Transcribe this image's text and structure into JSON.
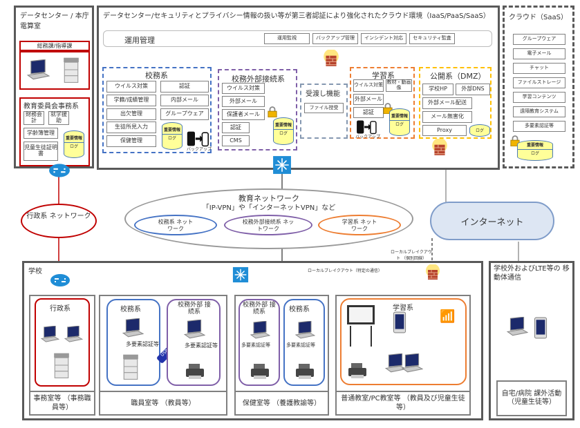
{
  "datacenter": {
    "title": "データセンター / 本庁 電算室",
    "general": "総務課/指導課",
    "board": {
      "title": "教育委員会事務系",
      "items": [
        "財務会計",
        "就学援助",
        "学齢簿管理",
        "児童生徒証明書"
      ],
      "db": [
        "重要情報",
        "ログ"
      ]
    }
  },
  "cloud_env": {
    "title": "データセンター/セキュリティとプライバシー情報の扱い等が第三者認証により強化されたクラウド環境（IaaS/PaaS/SaaS）",
    "ops": {
      "title": "運用管理",
      "items": [
        "運用監視",
        "バックアップ管理",
        "インシデント対応",
        "セキュリティ監査"
      ]
    },
    "koumu": {
      "title": "校務系",
      "left": [
        "ウイルス対策",
        "学籍/成績管理",
        "出欠管理",
        "生徒所見入力",
        "保健管理"
      ],
      "right": [
        "認証",
        "内部メール",
        "グループウェア"
      ],
      "db": [
        "重要情報",
        "ログ"
      ],
      "backup": "バックアップ"
    },
    "koumu_ext": {
      "title": "校務外部接続系",
      "items": [
        "ウイルス対策",
        "外部メール",
        "保護者メール",
        "認証",
        "CMS"
      ],
      "db": [
        "重要情報",
        "ログ"
      ]
    },
    "transfer": {
      "title": "受渡し機能",
      "items": [
        "ファイル授受"
      ]
    },
    "learning": {
      "title": "学習系",
      "items": [
        "ウイルス対策",
        "教材・動画像",
        "外部メール",
        "認証"
      ],
      "db": [
        "重要情報",
        "ログ"
      ],
      "backup": "バックアップ"
    },
    "dmz": {
      "title": "公開系（DMZ）",
      "items": [
        "学校HP",
        "外部DNS",
        "外部メール配送",
        "メール無害化",
        "Proxy"
      ],
      "log": "ログ"
    }
  },
  "saas": {
    "title": "クラウド（SaaS）",
    "items": [
      "グループウェア",
      "電子メール",
      "チャット",
      "ファイルストレージ",
      "学習コンテンツ",
      "遠隔教育システム",
      "多要素認証等"
    ],
    "db": [
      "重要情報",
      "ログ"
    ]
  },
  "admin_network": "行政系 ネットワーク",
  "edu_network": {
    "title": "教育ネットワーク",
    "subtitle": "「IP-VPN」や「インターネットVPN」など",
    "items": [
      "校務系 ネットワーク",
      "校務外部接続系 ネットワーク",
      "学習系 ネットワーク"
    ]
  },
  "internet": "インターネット",
  "breakout_individual": "ローカルブレイクアウト （個別回線）",
  "breakout_specific": "ローカルブレイクアウト（特定の通信）",
  "school": {
    "title": "学校",
    "office": {
      "group": "行政系",
      "label": "事務室等 （事務職員等）"
    },
    "staff": {
      "groups": [
        "校務系",
        "校務外部 接続系"
      ],
      "mfa": "多要素認証等",
      "usb": "USB",
      "label": "職員室等 （教員等）"
    },
    "health": {
      "groups": [
        "校務外部 接続系",
        "校務系"
      ],
      "mfa": "多要素認証等",
      "label": "保健室等 （養護教諭等）"
    },
    "classroom": {
      "group": "学習系",
      "label": "普通教室/PC教室等 （教員及び児童生徒等）"
    }
  },
  "outside": {
    "title": "学校外およびLTE等の 移動体通信",
    "label": "自宅/病院 課外活動 （児童生徒等）"
  },
  "colors": {
    "koumu": "#4472c4",
    "koumu_ext": "#7f5fa8",
    "learning": "#ed7d31",
    "dmz": "#ffc000",
    "admin": "#c00000",
    "gray": "#7f7f7f"
  }
}
